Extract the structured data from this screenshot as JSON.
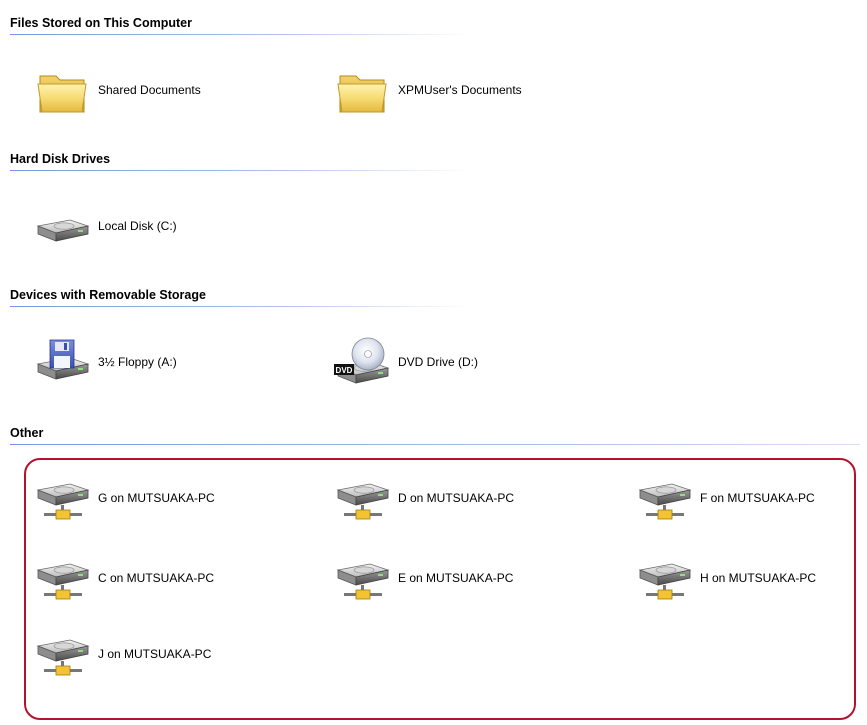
{
  "groups": {
    "files": {
      "title": "Files Stored on This Computer",
      "items": [
        "Shared Documents",
        "XPMUser's Documents"
      ]
    },
    "hard_disks": {
      "title": "Hard Disk Drives",
      "items": [
        "Local Disk (C:)"
      ]
    },
    "removable": {
      "title": "Devices with Removable Storage",
      "items": [
        "3½ Floppy (A:)",
        "DVD Drive (D:)"
      ],
      "dvd_badge": "DVD"
    },
    "other": {
      "title": "Other",
      "items": [
        "G on MUTSUAKA-PC",
        "D on MUTSUAKA-PC",
        "F on MUTSUAKA-PC",
        "C on MUTSUAKA-PC",
        "E on MUTSUAKA-PC",
        "H on MUTSUAKA-PC",
        "J on MUTSUAKA-PC"
      ]
    }
  },
  "colors": {
    "highlight": "#b3122e",
    "header_rule": "#7a96df",
    "folder": "#f5d76e"
  },
  "icons": {
    "folder": "folder-icon",
    "hard_disk": "hard-disk-icon",
    "floppy": "floppy-drive-icon",
    "dvd": "dvd-drive-icon",
    "network_drive": "network-drive-icon"
  }
}
